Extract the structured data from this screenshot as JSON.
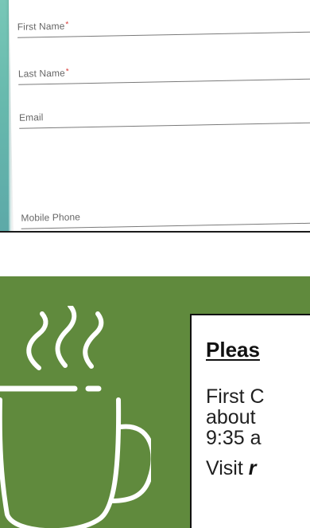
{
  "form": {
    "fields": [
      {
        "label": "First Name",
        "required": true,
        "required_mark": "*"
      },
      {
        "label": "Last Name",
        "required": true,
        "required_mark": "*"
      },
      {
        "label": "Email",
        "required": false
      },
      {
        "label": "Mobile Phone",
        "required": false
      }
    ],
    "colors": {
      "label": "#666666",
      "required": "#d9413d",
      "line": "#7a7a7a",
      "teal_edge": "#67b9ad"
    }
  },
  "promo": {
    "background_color": "#608a3d",
    "icon": "coffee-mug-icon",
    "notice": {
      "title": "Pleas",
      "body_lines": [
        "First C",
        "about",
        "9:35 a"
      ],
      "visit_prefix": "Visit ",
      "visit_link": "r"
    }
  }
}
